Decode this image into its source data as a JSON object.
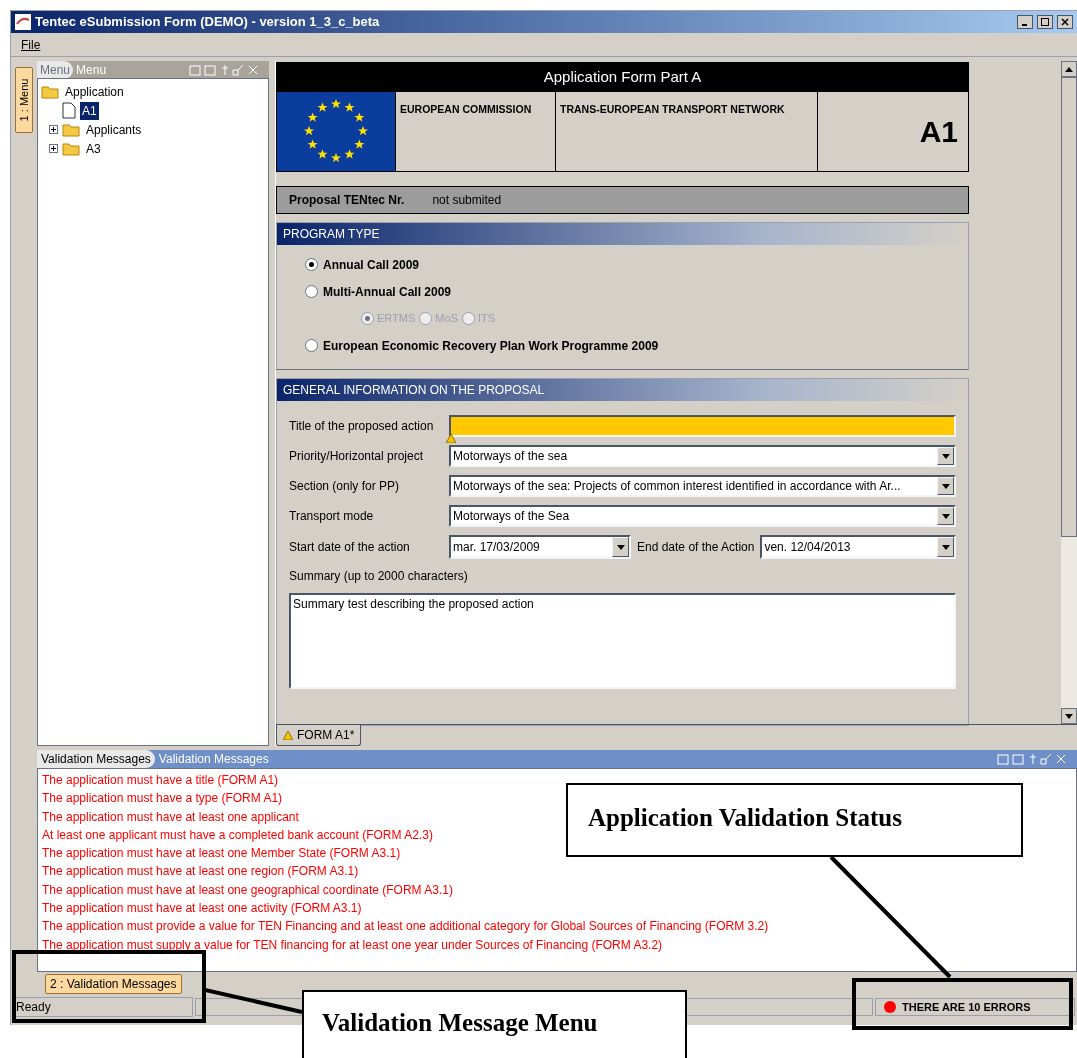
{
  "window": {
    "title": "Tentec eSubmission Form (DEMO) - version 1_3_c_beta"
  },
  "menu_bar": [
    "File"
  ],
  "side_tabs": [
    {
      "label": "1 : Menu"
    }
  ],
  "tree_panel": {
    "tabs": [
      {
        "label": "Menu",
        "selected": true
      },
      {
        "label": "Menu",
        "selected": false
      }
    ],
    "tree": [
      {
        "label": "Application",
        "kind": "folder",
        "selected": false,
        "children": [
          {
            "label": "A1",
            "kind": "file",
            "selected": true
          },
          {
            "label": "Applicants",
            "kind": "folder",
            "expanded": false,
            "selected": false
          },
          {
            "label": "A3",
            "kind": "folder",
            "expanded": false,
            "selected": false
          }
        ]
      }
    ]
  },
  "form": {
    "title": "Application Form Part A",
    "header_cells": [
      "EUROPEAN COMMISSION",
      "TRANS-EUROPEAN TRANSPORT NETWORK"
    ],
    "code": "A1",
    "proposal": {
      "label": "Proposal TENtec Nr.",
      "value": "not submited"
    },
    "program_type": {
      "title": "PROGRAM TYPE",
      "options": [
        {
          "label": "Annual Call 2009",
          "selected": true
        },
        {
          "label": "Multi-Annual Call 2009",
          "selected": false,
          "suboptions": [
            {
              "label": "ERTMS",
              "selected": true
            },
            {
              "label": "MoS",
              "selected": false
            },
            {
              "label": "ITS",
              "selected": false
            }
          ]
        },
        {
          "label": "European Economic Recovery Plan Work Programme 2009",
          "selected": false
        }
      ]
    },
    "general_info": {
      "title": "GENERAL INFORMATION ON THE PROPOSAL",
      "fields": [
        {
          "label": "Title of the proposed action",
          "kind": "text",
          "warning": true
        },
        {
          "label": "Priority/Horizontal project",
          "kind": "select",
          "value": "Motorways of the sea"
        },
        {
          "label": "Section (only for PP)",
          "kind": "select",
          "value": "Motorways of the sea: Projects of common interest identified in accordance with Ar..."
        },
        {
          "label": "Transport mode",
          "kind": "select",
          "value": "Motorways of the Sea"
        }
      ],
      "start_date": {
        "label": "Start date of the action",
        "value": "mar. 17/03/2009"
      },
      "end_date": {
        "label": "End date of the Action",
        "value": "ven. 12/04/2013"
      },
      "summary": {
        "label": "Summary (up to 2000 characters)",
        "value": "Summary test describing the proposed action"
      }
    },
    "tabs": [
      {
        "label": "FORM A1*",
        "warning": true,
        "selected": true
      }
    ]
  },
  "validation": {
    "tabs": [
      {
        "label": "Validation Messages",
        "selected": true
      },
      {
        "label": "Validation Messages",
        "selected": false
      }
    ],
    "messages": [
      "The application must have a title (FORM A1)",
      "The application must have a type (FORM A1)",
      "The application must have at least one applicant",
      "At least one applicant must have a completed bank account (FORM A2.3)",
      "The application must have at least one Member State (FORM A3.1)",
      "The application must have at least one region (FORM A3.1)",
      "The application must have at least one geographical coordinate (FORM A3.1)",
      "The application must have at least one activity (FORM A3.1)",
      "The application must provide a value for TEN Financing and at least one additional category for Global Sources of Financing (FORM 3.2)",
      "The application must supply a value for TEN financing for at least one year under Sources of Financing (FORM A3.2)"
    ]
  },
  "bottom_tabs": [
    {
      "label": "2 : Validation Messages"
    }
  ],
  "status_bar": {
    "text": "Ready",
    "errors": "THERE ARE 10 ERRORS",
    "color": "#ff0000"
  },
  "annotations": [
    "Application Validation Status",
    "Validation Message Menu"
  ]
}
